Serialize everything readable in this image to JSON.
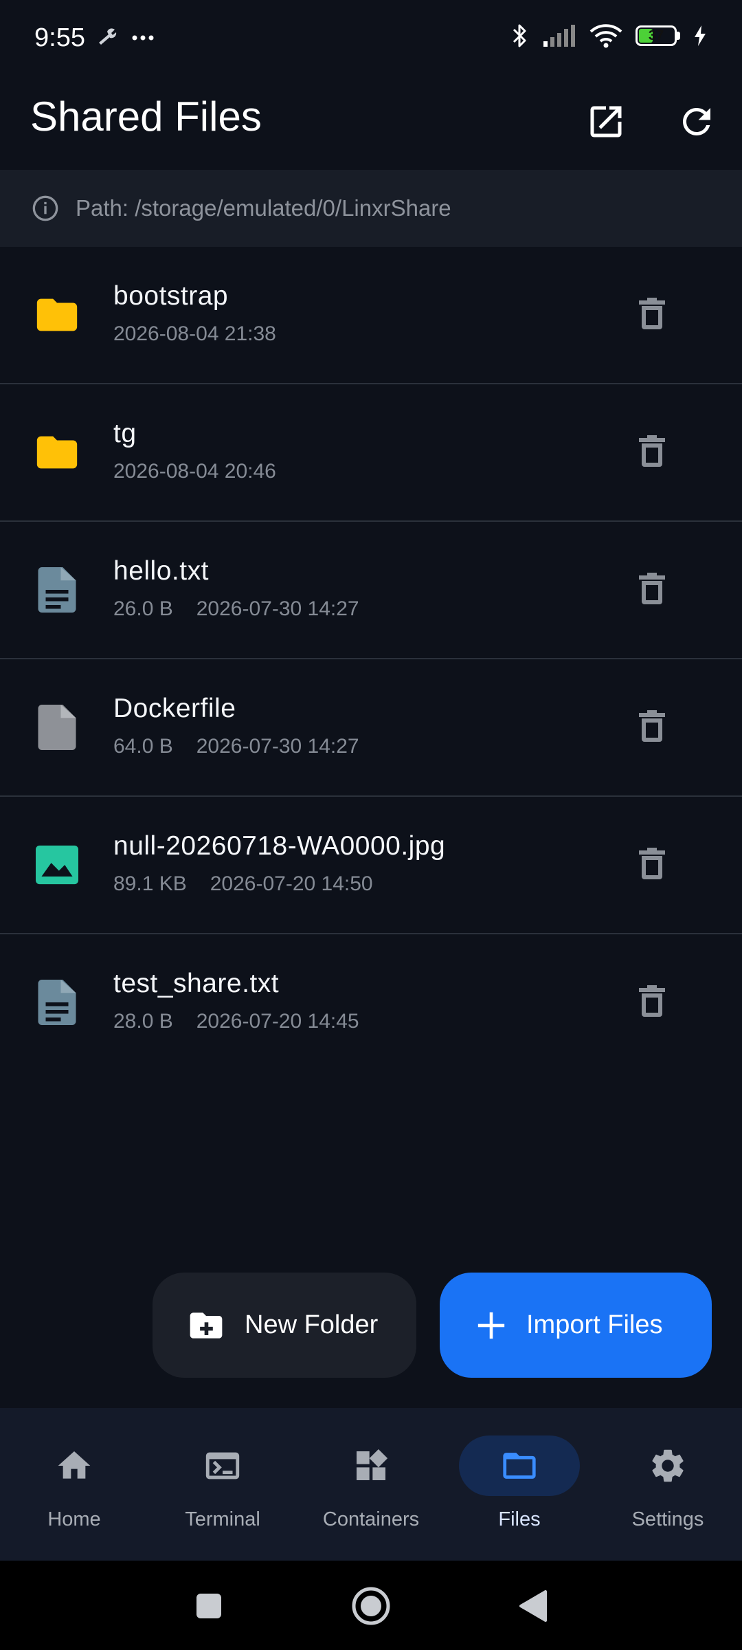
{
  "status_bar": {
    "time": "9:55",
    "battery_level": "37",
    "icons": [
      "wrench-icon",
      "more-dots-icon",
      "bluetooth-icon",
      "signal-icon",
      "wifi-icon",
      "battery-icon",
      "charging-icon"
    ]
  },
  "app_bar": {
    "title": "Shared Files",
    "actions": [
      "open-external-icon",
      "refresh-icon"
    ]
  },
  "path_bar": {
    "text": "Path: /storage/emulated/0/LinxrShare"
  },
  "files": [
    {
      "name": "bootstrap",
      "size": "",
      "modified": "2026-08-04 21:38",
      "type": "folder"
    },
    {
      "name": "tg",
      "size": "",
      "modified": "2026-08-04 20:46",
      "type": "folder"
    },
    {
      "name": "hello.txt",
      "size": "26.0 B",
      "modified": "2026-07-30 14:27",
      "type": "text"
    },
    {
      "name": "Dockerfile",
      "size": "64.0 B",
      "modified": "2026-07-30 14:27",
      "type": "file"
    },
    {
      "name": "null-20260718-WA0000.jpg",
      "size": "89.1 KB",
      "modified": "2026-07-20 14:50",
      "type": "image"
    },
    {
      "name": "test_share.txt",
      "size": "28.0 B",
      "modified": "2026-07-20 14:45",
      "type": "text"
    }
  ],
  "actions": {
    "new_folder": "New Folder",
    "import_files": "Import Files"
  },
  "bottom_nav": {
    "items": [
      {
        "label": "Home",
        "icon": "home-icon"
      },
      {
        "label": "Terminal",
        "icon": "terminal-icon"
      },
      {
        "label": "Containers",
        "icon": "containers-icon"
      },
      {
        "label": "Files",
        "icon": "folder-icon"
      },
      {
        "label": "Settings",
        "icon": "gear-icon"
      }
    ],
    "active": "Files"
  },
  "colors": {
    "background": "#0d111a",
    "accent": "#1a73f5",
    "folder": "#ffc107",
    "text_file": "#6b8a9c",
    "image_file": "#26c6a0"
  }
}
